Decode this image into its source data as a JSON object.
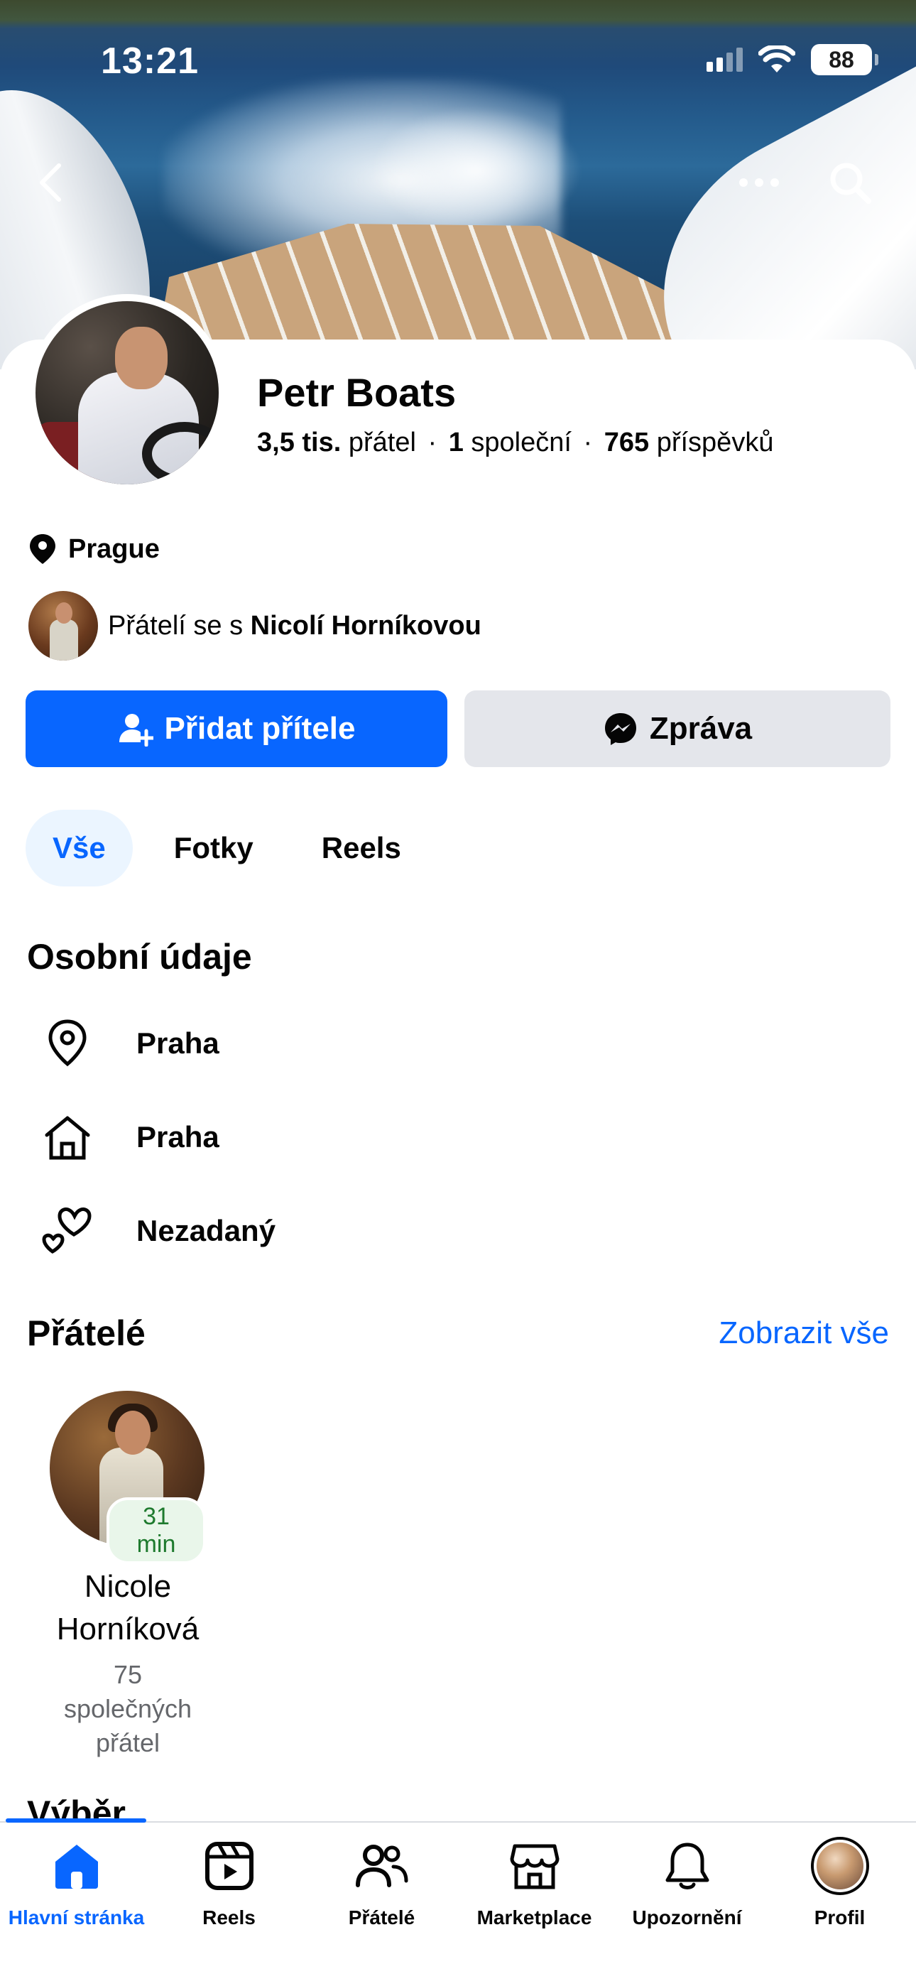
{
  "status_bar": {
    "time": "13:21",
    "battery": "88"
  },
  "profile": {
    "name": "Petr Boats",
    "friends_count": "3,5 tis.",
    "friends_label": "přátel",
    "mutual_count": "1",
    "mutual_label": "společní",
    "posts_count": "765",
    "posts_label": "příspěvků",
    "location": "Prague",
    "mutual_prefix": "Přátelí se s",
    "mutual_name": "Nicolí Horníkovou"
  },
  "actions": {
    "add_friend": "Přidat přítele",
    "message": "Zpráva"
  },
  "tabs": [
    {
      "label": "Vše",
      "active": true
    },
    {
      "label": "Fotky",
      "active": false
    },
    {
      "label": "Reels",
      "active": false
    }
  ],
  "personal": {
    "title": "Osobní údaje",
    "items": [
      {
        "icon": "location-pin-icon",
        "label": "Praha"
      },
      {
        "icon": "home-icon",
        "label": "Praha"
      },
      {
        "icon": "relationship-hearts-icon",
        "label": "Nezadaný"
      }
    ]
  },
  "friends": {
    "title": "Přátelé",
    "see_all": "Zobrazit vše",
    "items": [
      {
        "name": "Nicole Horníková",
        "badge": "31 min",
        "mutual": "75 společných přátel"
      }
    ]
  },
  "next_section": "Výběr",
  "bottom_nav": [
    {
      "label": "Hlavní stránka",
      "icon": "home-icon",
      "active": true
    },
    {
      "label": "Reels",
      "icon": "reels-icon",
      "active": false
    },
    {
      "label": "Přátelé",
      "icon": "friends-icon",
      "active": false
    },
    {
      "label": "Marketplace",
      "icon": "marketplace-icon",
      "active": false
    },
    {
      "label": "Upozornění",
      "icon": "bell-icon",
      "active": false
    },
    {
      "label": "Profil",
      "icon": "profile-avatar",
      "active": false
    }
  ],
  "colors": {
    "accent": "#0866ff",
    "secondary_button": "#e4e6eb",
    "active_tab_bg": "#ebf5ff",
    "online_badge": "#1e7a2e"
  }
}
